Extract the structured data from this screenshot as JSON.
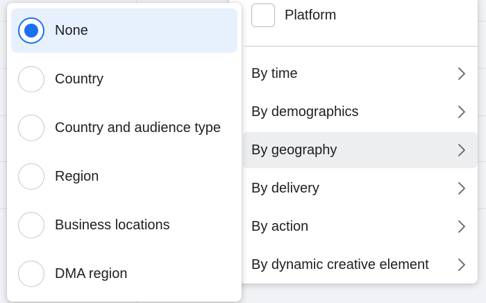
{
  "breakdown_menu": {
    "platform_label": "Platform",
    "platform_checked": false,
    "items": [
      {
        "label": "By time"
      },
      {
        "label": "By demographics"
      },
      {
        "label": "By geography",
        "active": true
      },
      {
        "label": "By delivery"
      },
      {
        "label": "By action"
      },
      {
        "label": "By dynamic creative element"
      }
    ]
  },
  "geography_menu": {
    "selected": "None",
    "options": [
      {
        "label": "None"
      },
      {
        "label": "Country"
      },
      {
        "label": "Country and audience type"
      },
      {
        "label": "Region"
      },
      {
        "label": "Business locations"
      },
      {
        "label": "DMA region"
      }
    ]
  },
  "colors": {
    "accent": "#1b6ff0",
    "selected_bg": "#e7f0fd",
    "hover_bg": "#edeef0"
  }
}
